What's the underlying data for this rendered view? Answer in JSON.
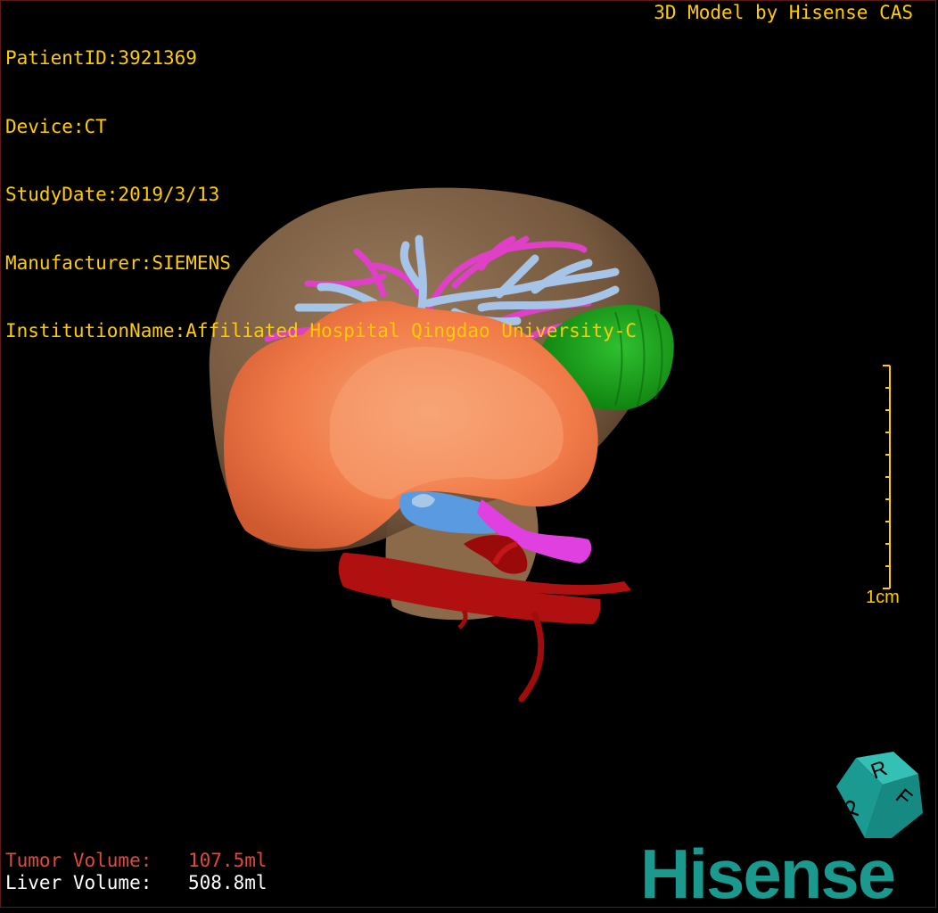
{
  "header": {
    "patient_id": "PatientID:3921369",
    "device": "Device:CT",
    "study_date": "StudyDate:2019/3/13",
    "manufacturer": "Manufacturer:SIEMENS",
    "institution": "InstitutionName:Affiliated Hospital Qingdao University-C"
  },
  "credit": "3D Model by Hisense CAS",
  "volumes": {
    "tumor_label": "Tumor Volume:",
    "tumor_value": "107.5ml",
    "liver_label": "Liver Volume:",
    "liver_value": "508.8ml"
  },
  "scale_bar": {
    "label": "1cm"
  },
  "orientation_cube": {
    "faces": [
      "P",
      "R",
      "F"
    ]
  },
  "logo": "Hisense",
  "colors": {
    "overlay_text": "#ffcc00",
    "tumor_text": "#e04a3a",
    "liver": "#8a6a48",
    "tumor": "#f07a48",
    "artery": "#b01010",
    "portal_vein": "#a6c4e8",
    "hepatic_vein": "#e040c8",
    "gallbladder": "#18a018",
    "ivc": "#5a9ae0",
    "logo": "#1a9a8e"
  }
}
